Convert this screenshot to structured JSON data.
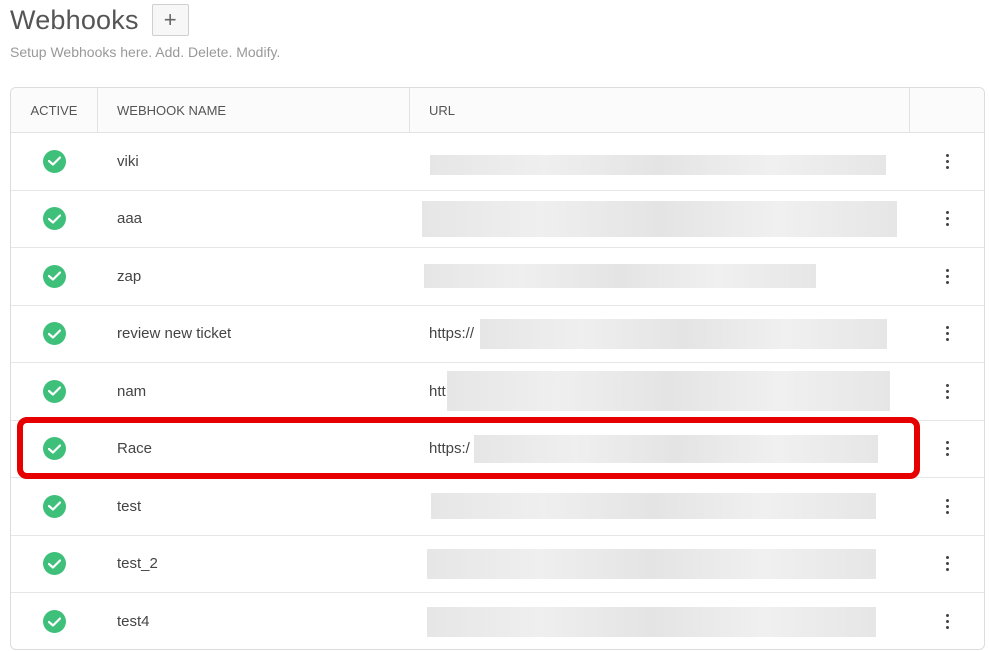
{
  "header": {
    "title": "Webhooks",
    "add_label": "+",
    "subtitle": "Setup Webhooks here. Add. Delete. Modify."
  },
  "table": {
    "columns": {
      "active": "ACTIVE",
      "name": "WEBHOOK NAME",
      "url": "URL",
      "actions": ""
    },
    "rows": [
      {
        "active": true,
        "name": "viki",
        "url_visible": ""
      },
      {
        "active": true,
        "name": "aaa",
        "url_visible": ""
      },
      {
        "active": true,
        "name": "zap",
        "url_visible": ""
      },
      {
        "active": true,
        "name": "review new ticket",
        "url_visible": "https://"
      },
      {
        "active": true,
        "name": "nam",
        "url_visible": "htt"
      },
      {
        "active": true,
        "name": "Race",
        "url_visible": "https:/"
      },
      {
        "active": true,
        "name": "test",
        "url_visible": ""
      },
      {
        "active": true,
        "name": "test_2",
        "url_visible": ""
      },
      {
        "active": true,
        "name": "test4",
        "url_visible": ""
      }
    ]
  },
  "highlighted_row": "Race",
  "colors": {
    "active_green": "#3fc07a",
    "highlight_red": "#e60000"
  }
}
